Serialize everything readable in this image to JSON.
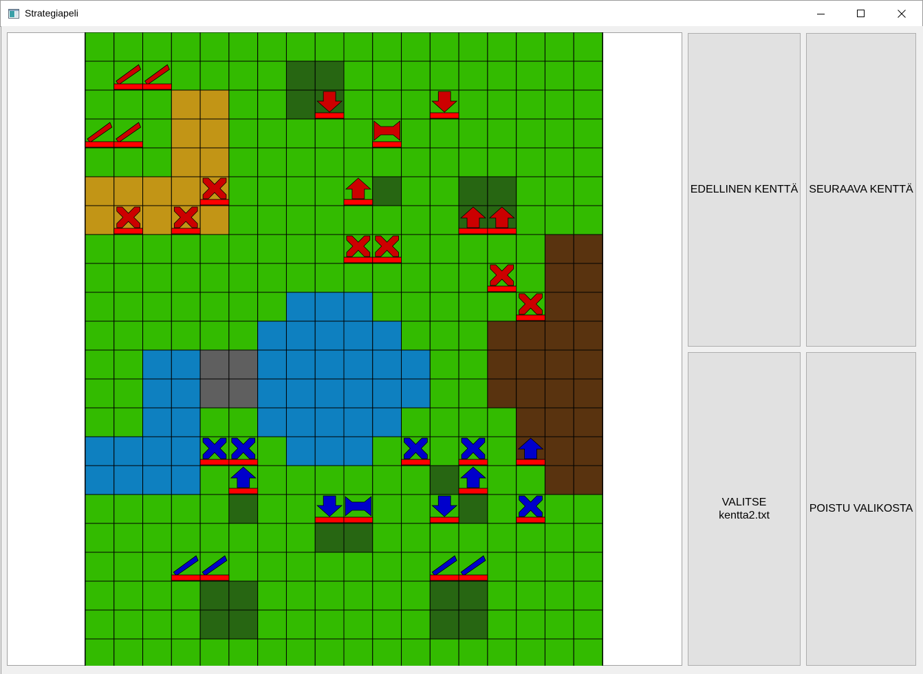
{
  "window": {
    "title": "Strategiapeli"
  },
  "buttons": {
    "previous": "EDELLINEN KENTTÄ",
    "next": "SEURAAVA KENTTÄ",
    "select_line1": "VALITSE",
    "select_line2": "kentta2.txt",
    "exit": "POISTU VALIKOSTA"
  },
  "map": {
    "columns": 18,
    "rows": 22,
    "legend": {
      "G": "grass",
      "F": "forest",
      "S": "sand",
      "W": "water",
      "R": "rock",
      "M": "mud"
    },
    "terrain_colors": {
      "G": "#33bb00",
      "F": "#276612",
      "S": "#c29516",
      "W": "#0e80c0",
      "R": "#5f5f5f",
      "M": "#59330f"
    },
    "tiles": [
      "GGGGGGGGGGGGGGGGGG",
      "GGGGGGGFFGGGGGGGGG",
      "GGGSSGGFFGGGGGGGGG",
      "GGGSSGGGGGGGGGGGGG",
      "GGGSSGGGGGGGGGGGGG",
      "SSSSSGGGGGFGGFFGGG",
      "SSSSSGGGGGGGGFFGGG",
      "GGGGGGGGGGGGGGGGMM",
      "GGGGGGGGGGGGGGGGMM",
      "GGGGGGGWWWGGGGGGMM",
      "GGGGGGWWWWWGGGMMMM",
      "GGWWRRWWWWWWGGMMMM",
      "GGWWRRWWWWWWGGMMMM",
      "GGWWGGWWWWWGGGGMMM",
      "WWWWGGGWWWGGGGGMMM",
      "WWWWGGGGGGGGFGGGMM",
      "GGGGGFGGGGGGGFGGGG",
      "GGGGGGGGFFGGGGGGGG",
      "GGGGGGGGGGGGGGGGGG",
      "GGGGFFGGGGGGFFGGGG",
      "GGGGFFGGGGGGFFGGGG",
      "GGGGGGGGGGGGGGGGGG"
    ],
    "unit_colors": {
      "red": "#cc0000",
      "blue": "#0000cc",
      "health": "#ff0000"
    },
    "units": [
      {
        "team": "red",
        "type": "artillery",
        "col": 1,
        "row": 1
      },
      {
        "team": "red",
        "type": "artillery",
        "col": 2,
        "row": 1
      },
      {
        "team": "red",
        "type": "arrow-down",
        "col": 8,
        "row": 2
      },
      {
        "team": "red",
        "type": "arrow-down",
        "col": 12,
        "row": 2
      },
      {
        "team": "red",
        "type": "artillery",
        "col": 0,
        "row": 3
      },
      {
        "team": "red",
        "type": "artillery",
        "col": 1,
        "row": 3
      },
      {
        "team": "red",
        "type": "bowtie",
        "col": 10,
        "row": 3
      },
      {
        "team": "red",
        "type": "cross",
        "col": 4,
        "row": 5
      },
      {
        "team": "red",
        "type": "arrow-up",
        "col": 9,
        "row": 5
      },
      {
        "team": "red",
        "type": "cross",
        "col": 1,
        "row": 6
      },
      {
        "team": "red",
        "type": "cross",
        "col": 3,
        "row": 6
      },
      {
        "team": "red",
        "type": "arrow-up",
        "col": 13,
        "row": 6
      },
      {
        "team": "red",
        "type": "arrow-up",
        "col": 14,
        "row": 6
      },
      {
        "team": "red",
        "type": "cross",
        "col": 9,
        "row": 7
      },
      {
        "team": "red",
        "type": "cross",
        "col": 10,
        "row": 7
      },
      {
        "team": "red",
        "type": "cross",
        "col": 14,
        "row": 8
      },
      {
        "team": "red",
        "type": "cross",
        "col": 15,
        "row": 9
      },
      {
        "team": "blue",
        "type": "cross",
        "col": 4,
        "row": 14
      },
      {
        "team": "blue",
        "type": "cross",
        "col": 5,
        "row": 14
      },
      {
        "team": "blue",
        "type": "cross",
        "col": 11,
        "row": 14
      },
      {
        "team": "blue",
        "type": "cross",
        "col": 13,
        "row": 14
      },
      {
        "team": "blue",
        "type": "arrow-up",
        "col": 15,
        "row": 14
      },
      {
        "team": "blue",
        "type": "arrow-up",
        "col": 5,
        "row": 15
      },
      {
        "team": "blue",
        "type": "arrow-up",
        "col": 13,
        "row": 15
      },
      {
        "team": "blue",
        "type": "arrow-down",
        "col": 8,
        "row": 16
      },
      {
        "team": "blue",
        "type": "bowtie",
        "col": 9,
        "row": 16
      },
      {
        "team": "blue",
        "type": "arrow-down",
        "col": 12,
        "row": 16
      },
      {
        "team": "blue",
        "type": "cross",
        "col": 15,
        "row": 16
      },
      {
        "team": "blue",
        "type": "artillery",
        "col": 3,
        "row": 18
      },
      {
        "team": "blue",
        "type": "artillery",
        "col": 4,
        "row": 18
      },
      {
        "team": "blue",
        "type": "artillery",
        "col": 12,
        "row": 18
      },
      {
        "team": "blue",
        "type": "artillery",
        "col": 13,
        "row": 18
      }
    ]
  }
}
